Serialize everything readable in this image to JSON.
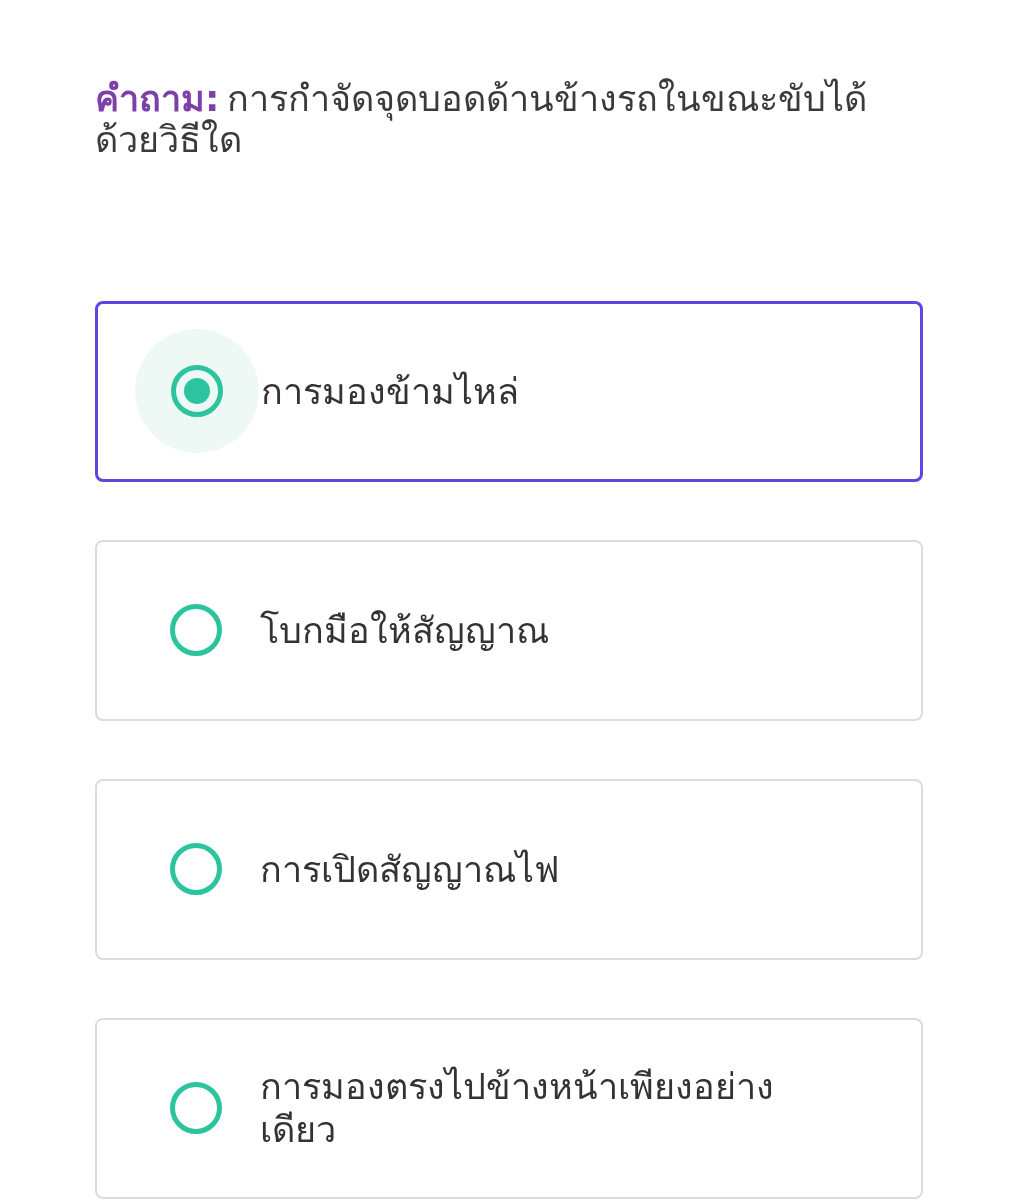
{
  "question": {
    "label": "คำถาม:",
    "text": "การกำจัดจุดบอดด้านข้างรถในขณะขับได้ด้วยวิธีใด"
  },
  "options": [
    {
      "text": "การมองข้ามไหล่",
      "selected": true
    },
    {
      "text": "โบกมือให้สัญญาณ",
      "selected": false
    },
    {
      "text": "การเปิดสัญญาณไฟ",
      "selected": false
    },
    {
      "text": "การมองตรงไปข้างหน้าเพียงอย่างเดียว",
      "selected": false
    }
  ]
}
